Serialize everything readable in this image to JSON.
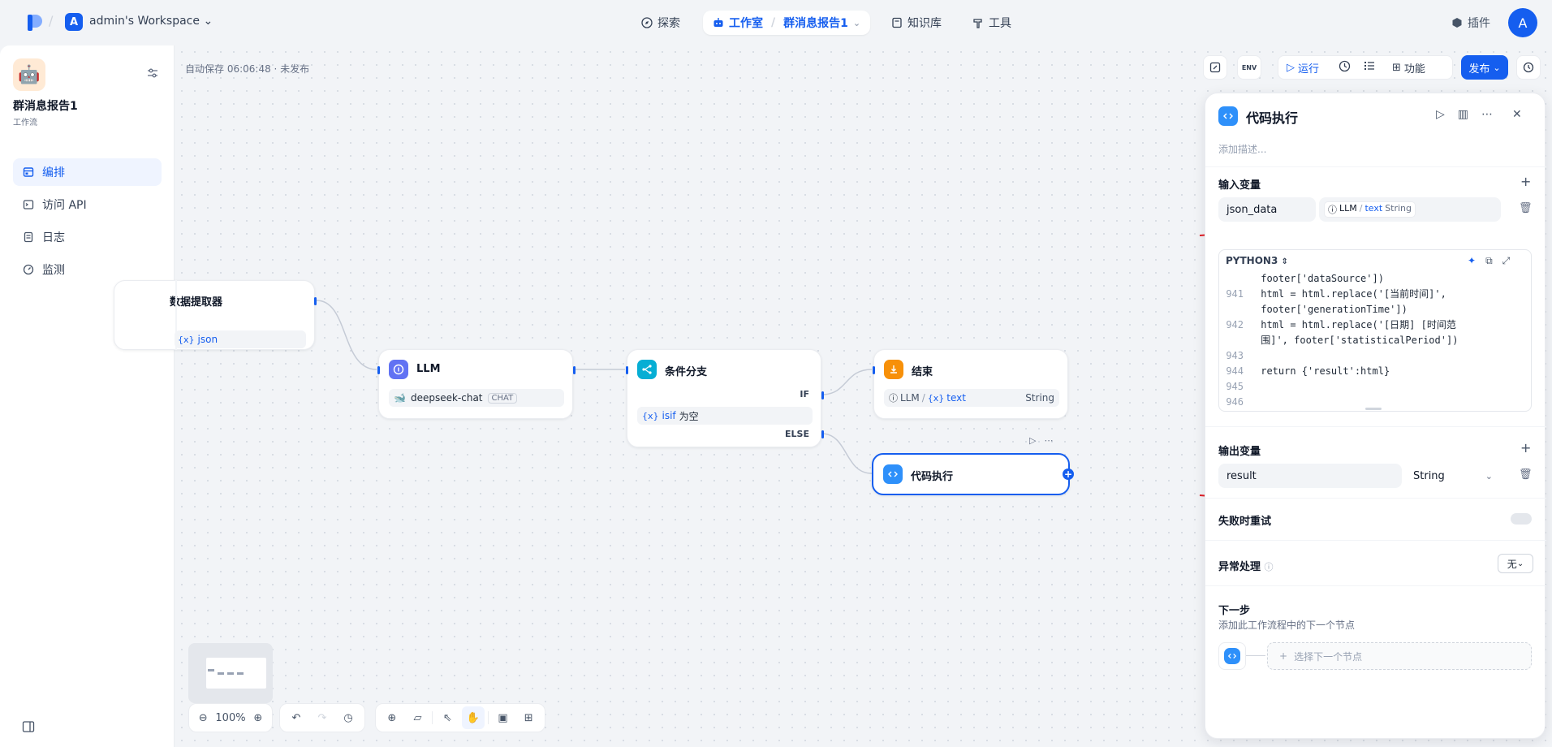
{
  "topbar": {
    "workspace_initial": "A",
    "workspace_name": "admin's Workspace",
    "nav": {
      "explore": "探索",
      "studio": "工作室",
      "current_app": "群消息报告1",
      "knowledge": "知识库",
      "tools": "工具"
    },
    "plugins": "插件",
    "user_initial": "A"
  },
  "sidebar": {
    "app_title": "群消息报告1",
    "app_type": "工作流",
    "items": [
      {
        "label": "编排"
      },
      {
        "label": "访问 API"
      },
      {
        "label": "日志"
      },
      {
        "label": "监测"
      }
    ]
  },
  "canvas": {
    "autosave": "自动保存 06:06:48 · 未发布",
    "toolbar": {
      "env": "ENV",
      "run": "运行",
      "features": "功能",
      "publish": "发布"
    },
    "nodes": {
      "extractor": {
        "title": "数据提取器",
        "var": "json"
      },
      "llm": {
        "title": "LLM",
        "model": "deepseek-chat",
        "mode": "CHAT"
      },
      "ifelse": {
        "title": "条件分支",
        "if": "IF",
        "else": "ELSE",
        "cond_var": "isif",
        "cond_op": "为空"
      },
      "end": {
        "title": "结束",
        "src": "LLM",
        "var": "text",
        "type": "String"
      },
      "code": {
        "title": "代码执行"
      }
    },
    "zoom": "100%"
  },
  "panel": {
    "title": "代码执行",
    "desc_placeholder": "添加描述...",
    "inputs_label": "输入变量",
    "input_name": "json_data",
    "input_src": "LLM",
    "input_var": "text",
    "input_type": "String",
    "lang": "PYTHON3",
    "code_lines": [
      {
        "n": "",
        "text": "    footer['dataSource'])"
      },
      {
        "n": "941",
        "text": "    html = html.replace('[当前时间]',"
      },
      {
        "n": "",
        "text": "    footer['generationTime'])"
      },
      {
        "n": "942",
        "text": "    html = html.replace('[日期] [时间范"
      },
      {
        "n": "",
        "text": "    围]', footer['statisticalPeriod'])"
      },
      {
        "n": "943",
        "text": ""
      },
      {
        "n": "944",
        "text": "    return {'result':html}"
      },
      {
        "n": "945",
        "text": ""
      },
      {
        "n": "946",
        "text": ""
      }
    ],
    "outputs_label": "输出变量",
    "output_name": "result",
    "output_type": "String",
    "retry_label": "失败时重试",
    "error_label": "异常处理",
    "error_value": "无",
    "next_label": "下一步",
    "next_desc": "添加此工作流程中的下一个节点",
    "next_select": "选择下一个节点"
  },
  "colors": {
    "accent": "#155eef",
    "annotation": "#e11d24"
  }
}
